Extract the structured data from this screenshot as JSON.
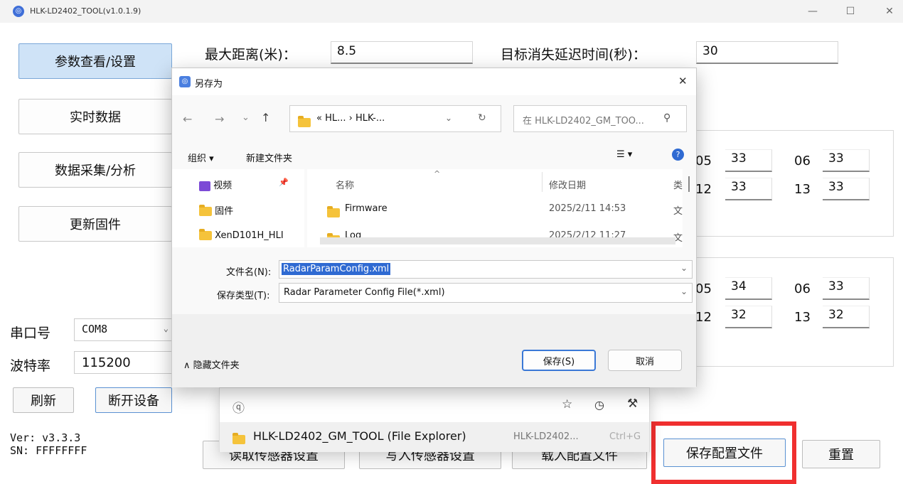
{
  "window": {
    "title": "HLK-LD2402_TOOL(v1.0.1.9)",
    "minimize": "—",
    "maximize": "☐",
    "close": "✕"
  },
  "nav": {
    "params": "参数查看/设置",
    "realtime": "实时数据",
    "collect": "数据采集/分析",
    "firmware": "更新固件"
  },
  "params": {
    "max_dist_label": "最大距离(米)：",
    "max_dist_value": "8.5",
    "delay_label": "目标消失延迟时间(秒)：",
    "delay_value": "30"
  },
  "grid1": [
    {
      "l": "05",
      "v": "33"
    },
    {
      "l": "06",
      "v": "33"
    },
    {
      "l": "12",
      "v": "33"
    },
    {
      "l": "13",
      "v": "33"
    }
  ],
  "grid2": [
    {
      "l": "05",
      "v": "34"
    },
    {
      "l": "06",
      "v": "33"
    },
    {
      "l": "12",
      "v": "32"
    },
    {
      "l": "13",
      "v": "32"
    }
  ],
  "serial": {
    "port_label": "串口号",
    "port_value": "COM8",
    "baud_label": "波特率",
    "baud_value": "115200",
    "refresh": "刷新",
    "disconnect": "断开设备"
  },
  "info": {
    "ver": "Ver: v3.3.3",
    "sn": "SN: FFFFFFFF"
  },
  "bottom": {
    "read": "读取传感器设置",
    "write": "写入传感器设置",
    "load": "载入配置文件",
    "save": "保存配置文件",
    "reset": "重置"
  },
  "autocomplete": {
    "item": "HLK-LD2402_GM_TOOL (File Explorer)",
    "path": "HLK-LD2402...",
    "shortcut": "Ctrl+G"
  },
  "dialog": {
    "title": "另存为",
    "path": "« HL... › HLK-...",
    "search_placeholder": "在 HLK-LD2402_GM_TOO...",
    "organize": "组织 ▾",
    "new_folder": "新建文件夹",
    "left_items": [
      "视频",
      "固件",
      "XenD101H_HLI"
    ],
    "col_name": "名称",
    "col_date": "修改日期",
    "col_type": "类",
    "rows": [
      {
        "name": "Firmware",
        "date": "2025/2/11 14:53",
        "type": "文"
      },
      {
        "name": "Log",
        "date": "2025/2/12 11:27",
        "type": "文"
      }
    ],
    "filename_label": "文件名(N):",
    "filename_value": "RadarParamConfig.xml",
    "filetype_label": "保存类型(T):",
    "filetype_value": "Radar Parameter Config File(*.xml)",
    "hide_folders": "隐藏文件夹",
    "save": "保存(S)",
    "cancel": "取消"
  },
  "colors": {
    "highlight_box": "#f02f2f",
    "selection": "#2f6ad2",
    "active_nav": "#cfe3f7"
  }
}
